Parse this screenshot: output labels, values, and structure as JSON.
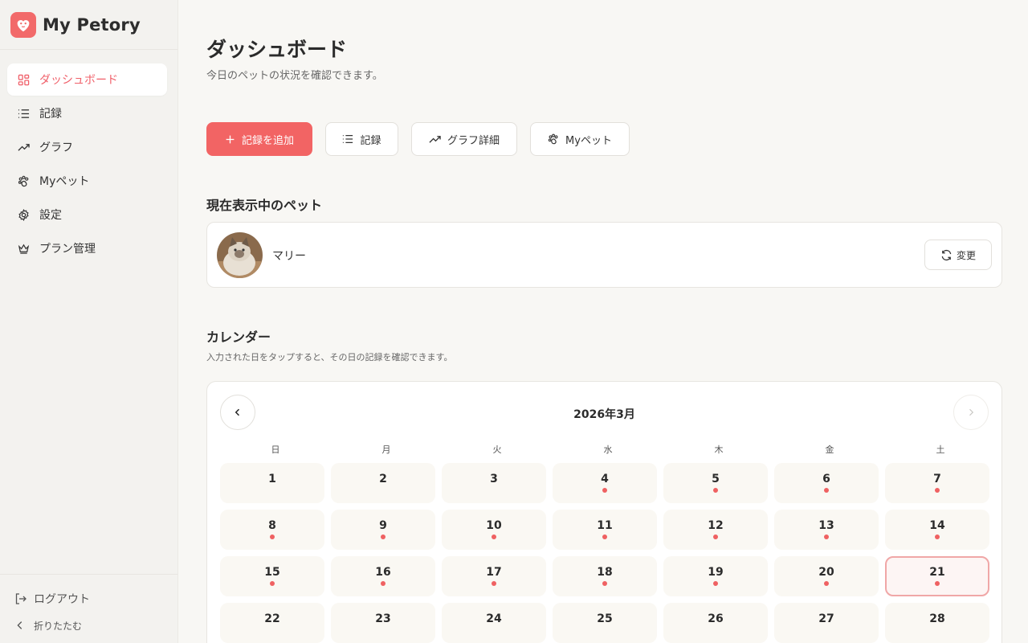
{
  "app": {
    "name": "My Petory"
  },
  "sidebar": {
    "items": [
      {
        "label": "ダッシュボード",
        "icon": "grid-icon",
        "active": true
      },
      {
        "label": "記録",
        "icon": "list-icon"
      },
      {
        "label": "グラフ",
        "icon": "trending-icon"
      },
      {
        "label": "Myペット",
        "icon": "paw-icon"
      },
      {
        "label": "設定",
        "icon": "gear-icon"
      },
      {
        "label": "プラン管理",
        "icon": "crown-icon"
      }
    ],
    "logout_label": "ログアウト",
    "collapse_label": "折りたたむ"
  },
  "header": {
    "title": "ダッシュボード",
    "subtitle": "今日のペットの状況を確認できます。"
  },
  "actions": {
    "add_record": "記録を追加",
    "records": "記録",
    "graph_detail": "グラフ詳細",
    "my_pets": "Myペット"
  },
  "current_pet": {
    "section_title": "現在表示中のペット",
    "name": "マリー",
    "change_label": "変更"
  },
  "calendar": {
    "title": "カレンダー",
    "subtitle": "入力された日をタップすると、その日の記録を確認できます。",
    "month_label": "2026年3月",
    "weekdays": [
      "日",
      "月",
      "火",
      "水",
      "木",
      "金",
      "土"
    ],
    "today": 21,
    "days": [
      {
        "n": "1",
        "dot": false
      },
      {
        "n": "2",
        "dot": false
      },
      {
        "n": "3",
        "dot": false
      },
      {
        "n": "4",
        "dot": true
      },
      {
        "n": "5",
        "dot": true
      },
      {
        "n": "6",
        "dot": true
      },
      {
        "n": "7",
        "dot": true
      },
      {
        "n": "8",
        "dot": true
      },
      {
        "n": "9",
        "dot": true
      },
      {
        "n": "10",
        "dot": true
      },
      {
        "n": "11",
        "dot": true
      },
      {
        "n": "12",
        "dot": true
      },
      {
        "n": "13",
        "dot": true
      },
      {
        "n": "14",
        "dot": true
      },
      {
        "n": "15",
        "dot": true
      },
      {
        "n": "16",
        "dot": true
      },
      {
        "n": "17",
        "dot": true
      },
      {
        "n": "18",
        "dot": true
      },
      {
        "n": "19",
        "dot": true
      },
      {
        "n": "20",
        "dot": true
      },
      {
        "n": "21",
        "dot": true
      },
      {
        "n": "22",
        "dot": false
      },
      {
        "n": "23",
        "dot": false
      },
      {
        "n": "24",
        "dot": false
      },
      {
        "n": "25",
        "dot": false
      },
      {
        "n": "26",
        "dot": false
      },
      {
        "n": "27",
        "dot": false
      },
      {
        "n": "28",
        "dot": false
      }
    ]
  },
  "colors": {
    "accent": "#f26464",
    "background": "#f8f7f4",
    "sidebar": "#f3f2ef"
  }
}
